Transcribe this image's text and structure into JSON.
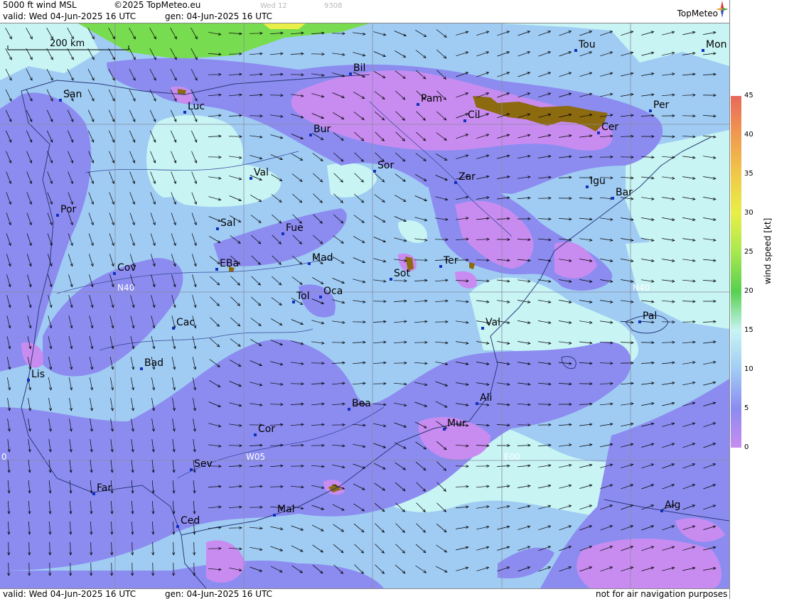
{
  "header": {
    "title": "5000 ft wind MSL",
    "copyright": "©2025 TopMeteo.eu",
    "faint_day": "Wed 12",
    "faint_code": "9308",
    "valid": "valid:  Wed  04-Jun-2025  16 UTC",
    "gen": "gen: 04-Jun-2025 16 UTC",
    "logo": "TopMeteo"
  },
  "footer": {
    "valid": "valid:  Wed  04-Jun-2025  16 UTC",
    "gen": "gen: 04-Jun-2025 16 UTC",
    "disclaimer": "not for air navigation purposes"
  },
  "scale_bar": "200 km",
  "grid_labels": {
    "n40_left": "N40",
    "n40_right": "N40",
    "w05": "W05",
    "e00": "E00",
    "w10": "0"
  },
  "cities": [
    "Tou",
    "Mon",
    "Bil",
    "San",
    "Pam",
    "Luc",
    "Cil",
    "Per",
    "Cer",
    "Bur",
    "Sor",
    "Val",
    "Zar",
    "Igu",
    "Bar",
    "Por",
    "Sal",
    "Fue",
    "Mad",
    "EBa",
    "Ter",
    "Cov",
    "Sot",
    "Oca",
    "Tol",
    "Pal",
    "Val",
    "Cac",
    "Bad",
    "Lis",
    "Bea",
    "Ali",
    "Cor",
    "Mur",
    "Sev",
    "Far",
    "Mal",
    "Ced",
    "Alg"
  ],
  "colorbar": {
    "title": "wind speed [kt]",
    "ticks": [
      "45",
      "40",
      "35",
      "30",
      "25",
      "20",
      "15",
      "10",
      "5",
      "0"
    ],
    "colors": {
      "c45": "#e8685a",
      "c40": "#f09a50",
      "c35": "#f0c848",
      "c30": "#e8ef48",
      "c25": "#a8e850",
      "c20": "#58d050",
      "c15": "#c8f4f4",
      "c10": "#a0ccf4",
      "c5": "#8c8cf0",
      "c0": "#c88cf0"
    }
  }
}
